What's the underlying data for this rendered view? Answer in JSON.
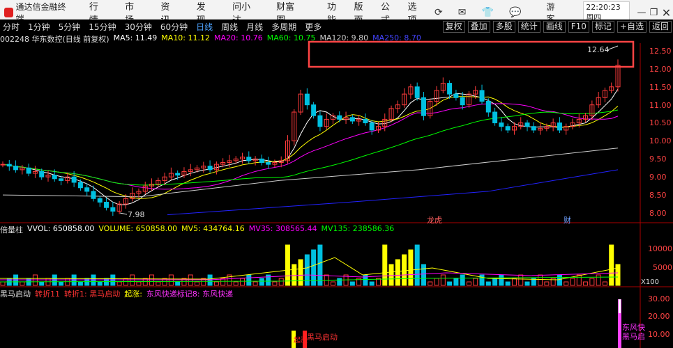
{
  "app": {
    "title": "通达信金融终端",
    "menu": [
      "行情",
      "市场",
      "资讯",
      "发现",
      "问小达",
      "财富圈"
    ],
    "menu_right": [
      "功能",
      "版面",
      "公式",
      "选项"
    ],
    "guest": "游客",
    "clock": "22:20:23 周四",
    "icons": [
      "refresh-icon",
      "envelope-icon",
      "shirt-icon",
      "chat-icon"
    ]
  },
  "periods": [
    "分时",
    "1分钟",
    "5分钟",
    "15分钟",
    "30分钟",
    "60分钟",
    "日线",
    "周线",
    "月线",
    "多周期",
    "更多"
  ],
  "active_period": "日线",
  "right_buttons": [
    "复权",
    "叠加",
    "多股",
    "统计",
    "画线",
    "F10",
    "标记",
    "+自选",
    "返回"
  ],
  "stock": {
    "label": "002248 华东数控(日线 前复权)",
    "ma": [
      {
        "label": "MA5: 11.49",
        "color": "#ffffff"
      },
      {
        "label": "MA10: 11.12",
        "color": "#ffff00"
      },
      {
        "label": "MA20: 10.76",
        "color": "#ff00ff"
      },
      {
        "label": "MA60: 10.75",
        "color": "#00ff00"
      },
      {
        "label": "MA120: 9.80",
        "color": "#cccccc"
      },
      {
        "label": "MA250: 8.70",
        "color": "#3333ff"
      }
    ]
  },
  "price_axis": [
    "12.50",
    "12.00",
    "11.50",
    "11.00",
    "10.50",
    "10.00",
    "9.50",
    "9.00",
    "8.50",
    "8.00"
  ],
  "price_labels": {
    "high": "12.64",
    "low": "7.98"
  },
  "events": [
    "龙虎",
    "财"
  ],
  "volume": {
    "ind_label": "倍量柱",
    "items": [
      {
        "label": "VVOL: 650858.00",
        "color": "#ffffff"
      },
      {
        "label": "VOLUME: 650858.00",
        "color": "#ffff00"
      },
      {
        "label": "MV5: 434764.16",
        "color": "#ffff00"
      },
      {
        "label": "MV35: 308565.44",
        "color": "#ff00ff"
      },
      {
        "label": "MV135: 238586.36",
        "color": "#00ff00"
      }
    ],
    "axis": [
      "10000",
      "5000"
    ],
    "unit": "X100"
  },
  "signal": {
    "ind_label": "黑马启动",
    "items": [
      {
        "label": "转折11",
        "color": "#ff3333"
      },
      {
        "label": "转折1: 黑马启动",
        "color": "#ff3333"
      },
      {
        "label": "起涨:",
        "color": "#ffff00"
      },
      {
        "label": "东风快递标记8: 东风快递",
        "color": "#ff33ff"
      }
    ],
    "axis": [
      "30.00",
      "20.00",
      "10.00"
    ],
    "texts": [
      "黑马启动",
      "起涨",
      "东风快",
      "黑马启"
    ]
  },
  "colors": {
    "up": "#ff3b3b",
    "down": "#00c0e0",
    "highlight_box": "#ff4444"
  }
}
